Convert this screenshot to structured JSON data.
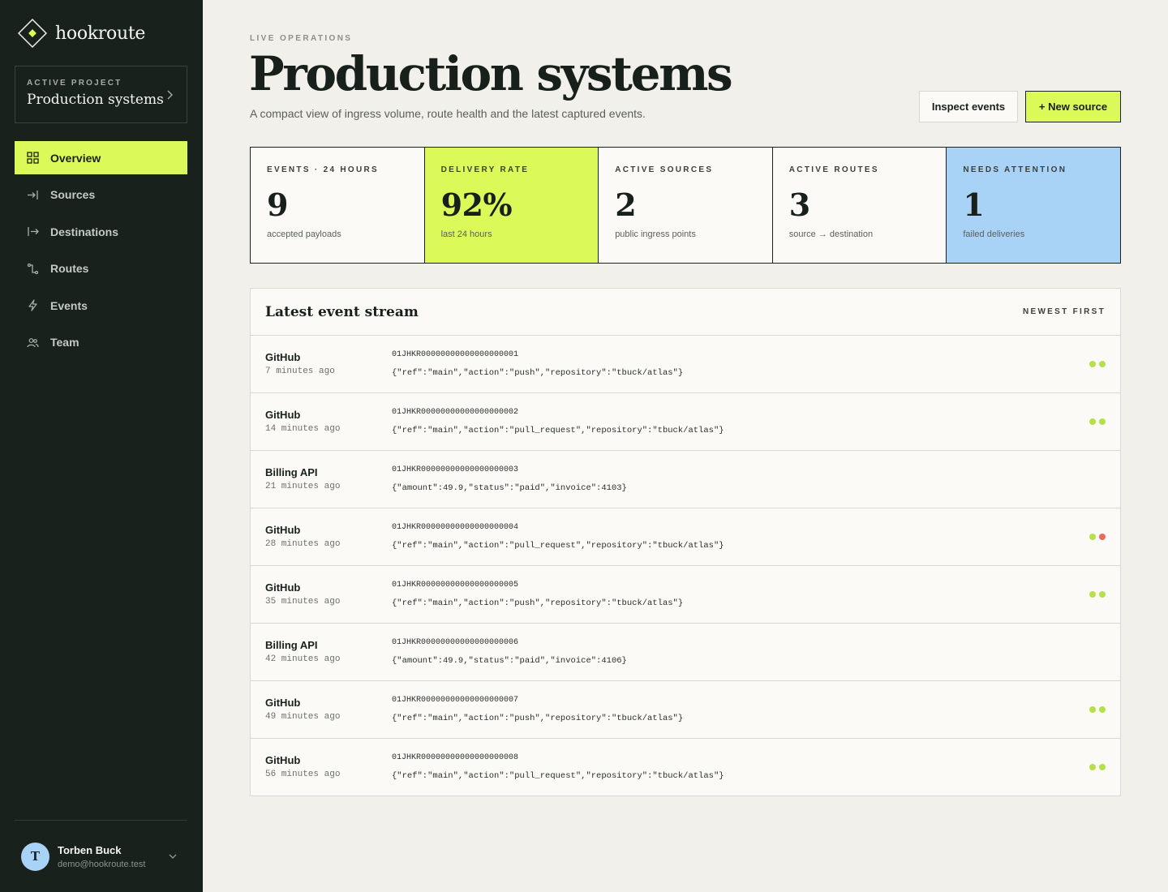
{
  "brand": {
    "name": "hookroute",
    "accent": "#dcf95a"
  },
  "project": {
    "eyebrow": "ACTIVE PROJECT",
    "name": "Production systems"
  },
  "nav": {
    "items": [
      {
        "label": "Overview",
        "icon": "grid-icon",
        "active": true
      },
      {
        "label": "Sources",
        "icon": "arrow-in-icon",
        "active": false
      },
      {
        "label": "Destinations",
        "icon": "arrow-out-icon",
        "active": false
      },
      {
        "label": "Routes",
        "icon": "route-icon",
        "active": false
      },
      {
        "label": "Events",
        "icon": "bolt-icon",
        "active": false
      },
      {
        "label": "Team",
        "icon": "users-icon",
        "active": false
      }
    ]
  },
  "user": {
    "initial": "T",
    "name": "Torben Buck",
    "email": "demo@hookroute.test"
  },
  "header": {
    "eyebrow": "LIVE OPERATIONS",
    "title": "Production systems",
    "subtitle": "A compact view of ingress volume, route health and the latest captured events.",
    "inspect_label": "Inspect events",
    "new_source_label": "+ New source"
  },
  "stats": [
    {
      "label": "EVENTS · 24 HOURS",
      "value": "9",
      "caption": "accepted payloads",
      "tone": "plain"
    },
    {
      "label": "DELIVERY RATE",
      "value": "92%",
      "caption": "last 24 hours",
      "tone": "green"
    },
    {
      "label": "ACTIVE SOURCES",
      "value": "2",
      "caption": "public ingress points",
      "tone": "plain"
    },
    {
      "label": "ACTIVE ROUTES",
      "value": "3",
      "caption": "source → destination",
      "tone": "plain"
    },
    {
      "label": "NEEDS ATTENTION",
      "value": "1",
      "caption": "failed deliveries",
      "tone": "blue"
    }
  ],
  "stream": {
    "title": "Latest event stream",
    "sort_label": "NEWEST FIRST",
    "status_colors": {
      "ok": "#b5e04a",
      "fail": "#ec6a5a"
    },
    "events": [
      {
        "source": "GitHub",
        "time": "7 minutes ago",
        "id": "01JHKR00000000000000000001",
        "payload": "{\"ref\":\"main\",\"action\":\"push\",\"repository\":\"tbuck/atlas\"}",
        "dots": [
          "ok",
          "ok"
        ]
      },
      {
        "source": "GitHub",
        "time": "14 minutes ago",
        "id": "01JHKR00000000000000000002",
        "payload": "{\"ref\":\"main\",\"action\":\"pull_request\",\"repository\":\"tbuck/atlas\"}",
        "dots": [
          "ok",
          "ok"
        ]
      },
      {
        "source": "Billing API",
        "time": "21 minutes ago",
        "id": "01JHKR00000000000000000003",
        "payload": "{\"amount\":49.9,\"status\":\"paid\",\"invoice\":4103}",
        "dots": []
      },
      {
        "source": "GitHub",
        "time": "28 minutes ago",
        "id": "01JHKR00000000000000000004",
        "payload": "{\"ref\":\"main\",\"action\":\"pull_request\",\"repository\":\"tbuck/atlas\"}",
        "dots": [
          "ok",
          "fail"
        ]
      },
      {
        "source": "GitHub",
        "time": "35 minutes ago",
        "id": "01JHKR00000000000000000005",
        "payload": "{\"ref\":\"main\",\"action\":\"push\",\"repository\":\"tbuck/atlas\"}",
        "dots": [
          "ok",
          "ok"
        ]
      },
      {
        "source": "Billing API",
        "time": "42 minutes ago",
        "id": "01JHKR00000000000000000006",
        "payload": "{\"amount\":49.9,\"status\":\"paid\",\"invoice\":4106}",
        "dots": []
      },
      {
        "source": "GitHub",
        "time": "49 minutes ago",
        "id": "01JHKR00000000000000000007",
        "payload": "{\"ref\":\"main\",\"action\":\"push\",\"repository\":\"tbuck/atlas\"}",
        "dots": [
          "ok",
          "ok"
        ]
      },
      {
        "source": "GitHub",
        "time": "56 minutes ago",
        "id": "01JHKR00000000000000000008",
        "payload": "{\"ref\":\"main\",\"action\":\"pull_request\",\"repository\":\"tbuck/atlas\"}",
        "dots": [
          "ok",
          "ok"
        ]
      }
    ]
  }
}
